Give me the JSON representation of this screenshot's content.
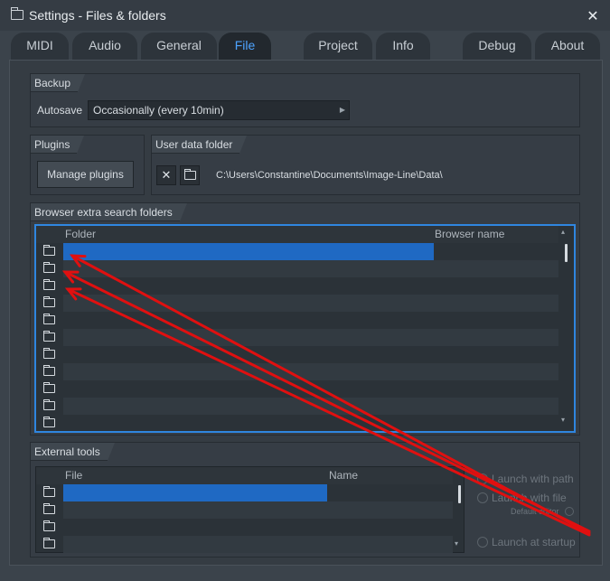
{
  "window": {
    "title": "Settings - Files & folders",
    "folder_icon": "folder-icon",
    "close_icon": "close-icon",
    "close_glyph": "✕"
  },
  "tabs": [
    {
      "label": "MIDI"
    },
    {
      "label": "Audio"
    },
    {
      "label": "General"
    },
    {
      "label": "File",
      "active": true
    },
    {
      "label": "Project"
    },
    {
      "label": "Info"
    },
    {
      "label": "Debug"
    },
    {
      "label": "About"
    }
  ],
  "backup": {
    "title": "Backup",
    "autosave_label": "Autosave",
    "autosave_value": "Occasionally (every 10min)"
  },
  "plugins": {
    "title": "Plugins",
    "manage_label": "Manage plugins"
  },
  "user_data": {
    "title": "User data folder",
    "clear_glyph": "✕",
    "path": "C:\\Users\\Constantine\\Documents\\Image-Line\\Data\\"
  },
  "browser_folders": {
    "title": "Browser extra search folders",
    "col_folder": "Folder",
    "col_browser_name": "Browser name",
    "selected_row": 0
  },
  "external_tools": {
    "title": "External tools",
    "col_file": "File",
    "col_name": "Name",
    "selected_row": 0,
    "launch_with_path": "Launch with path",
    "launch_with_file": "Launch with file",
    "default_editor": "Default editor",
    "launch_at_startup": "Launch at startup"
  },
  "colors": {
    "accent": "#2f86e0",
    "selection": "#1f69c3",
    "active_tab": "#4da3ff",
    "arrow": "#e01010"
  }
}
